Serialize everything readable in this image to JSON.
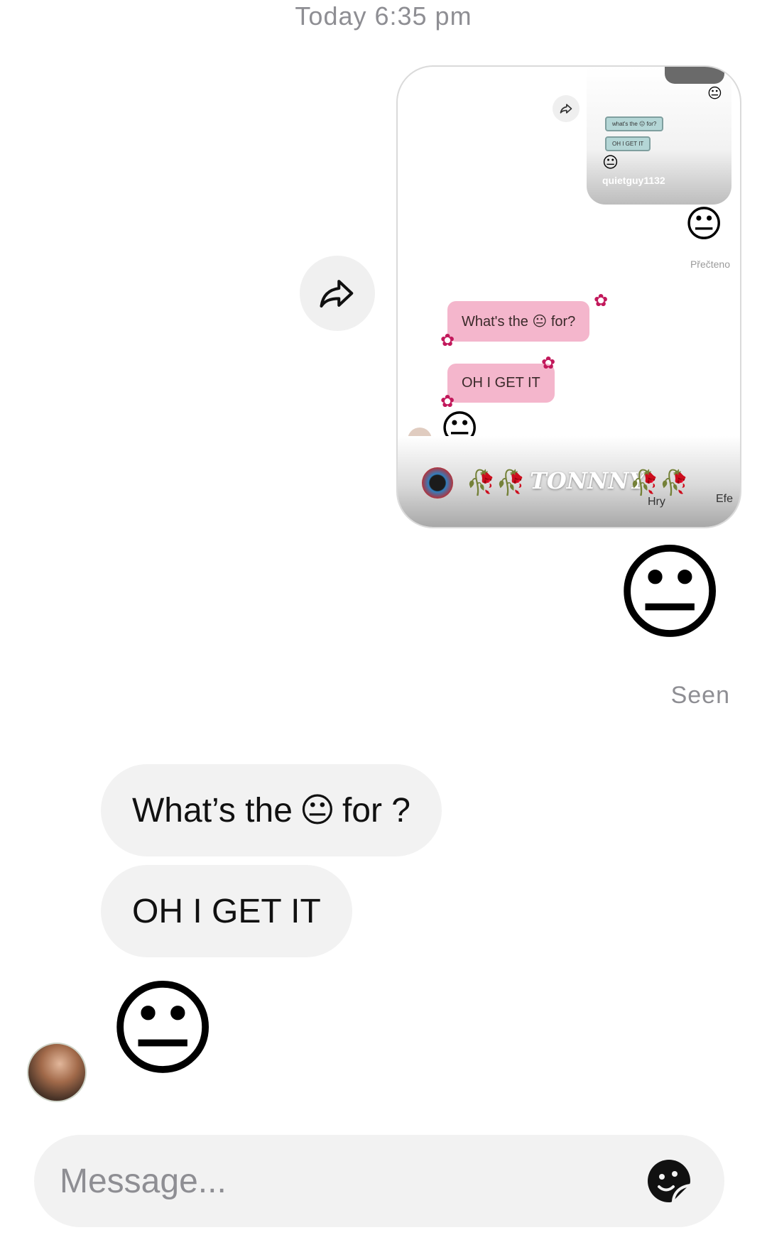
{
  "header": {
    "timestamp": "Today 6:35 pm"
  },
  "shared_post": {
    "nested_chat": {
      "bubble_1": "what's the 😐 for?",
      "bubble_2": "OH I GET IT",
      "username": "quietguy1132",
      "emoji": "😐"
    },
    "read_receipt": "Přečteno",
    "bubble_1_prefix": "What's the",
    "bubble_1_suffix": "for?",
    "bubble_2": "OH I GET IT",
    "emoji": "😐",
    "story_name": "TONNNY",
    "label_hry": "Hry",
    "label_efe": "Efe"
  },
  "sent": {
    "emoji": "😐",
    "status": "Seen"
  },
  "received": {
    "message_1_prefix": "What’s the",
    "message_1_emoji": "😐",
    "message_1_suffix": "for ?",
    "message_2": "OH I GET IT",
    "emoji": "😐"
  },
  "composer": {
    "placeholder": "Message..."
  },
  "icons": {
    "share": "share-arrow-icon",
    "sticker": "sticker-icon"
  },
  "colors": {
    "bubble_gray": "#f2f2f2",
    "secondary_text": "#8e8e93",
    "pink_bubble": "#f4b6cc"
  }
}
